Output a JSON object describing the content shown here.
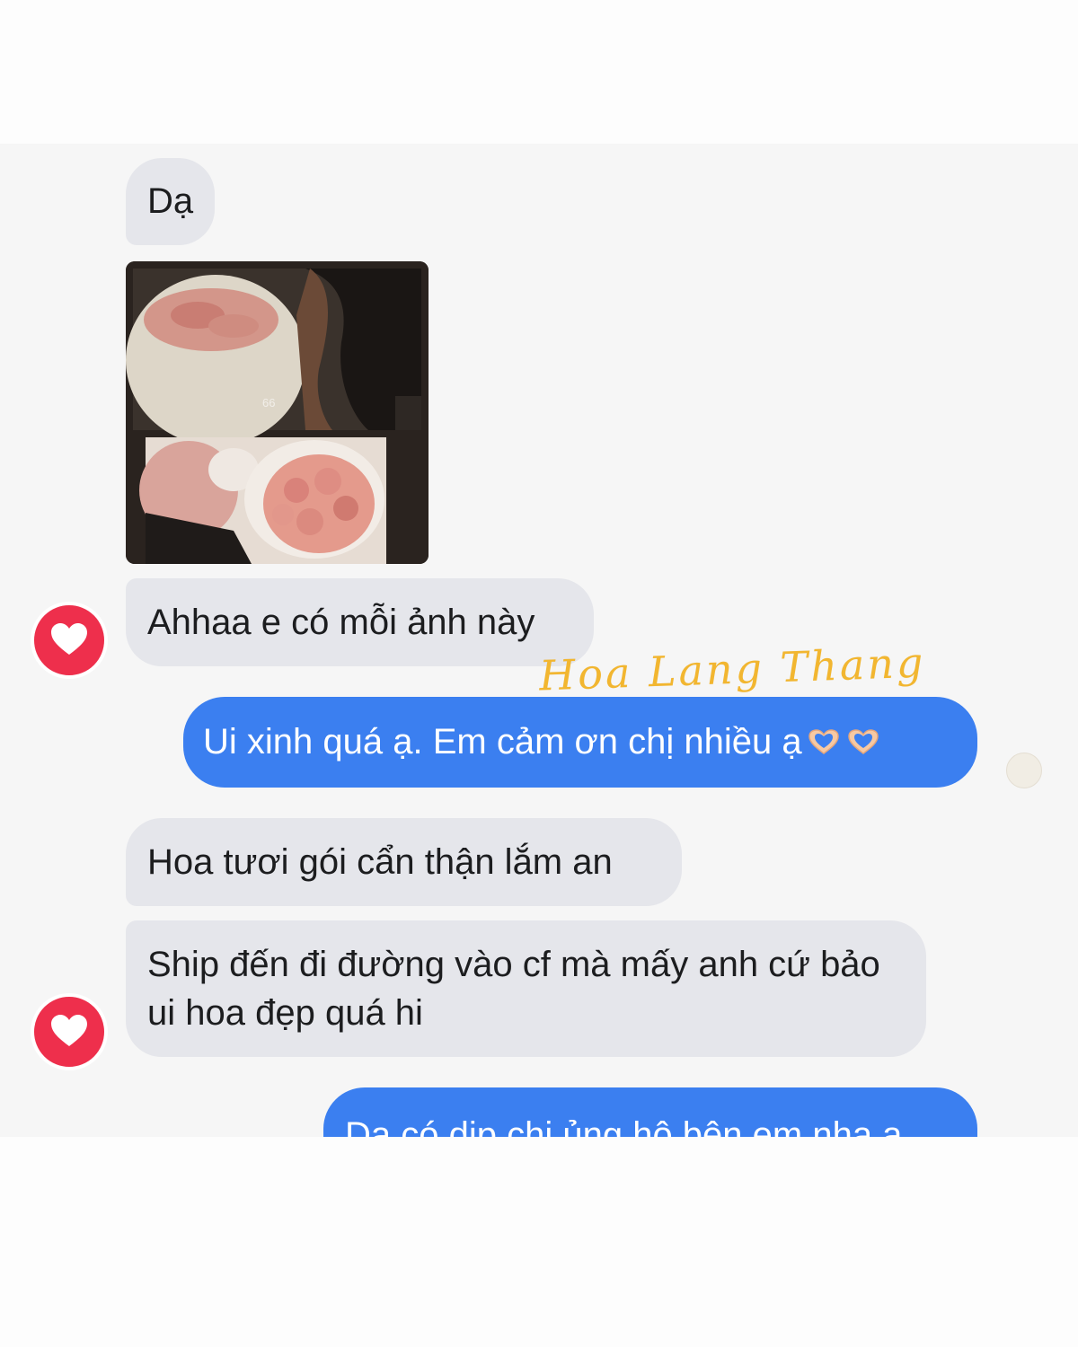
{
  "messages": [
    {
      "side": "incoming",
      "text": "Dạ"
    },
    {
      "side": "incoming",
      "type": "photo",
      "content": "bouquet-photo"
    },
    {
      "side": "incoming",
      "text": "Ahhaa e có mỗi ảnh này",
      "reaction": "heart"
    },
    {
      "side": "outgoing",
      "text": "Ui xinh quá ạ. Em cảm ơn chị nhiều ạ",
      "emoji": [
        "heart-hands-emoji",
        "heart-hands-emoji"
      ]
    },
    {
      "side": "incoming",
      "text": "Hoa tươi gói cẩn thận lắm an"
    },
    {
      "side": "incoming",
      "text": "Ship đến đi đường vào cf mà mấy anh cứ bảo ui hoa đẹp quá hi",
      "reaction": "heart"
    },
    {
      "side": "outgoing",
      "text": "Dạ có dịp chị ủng hộ bên em nha ạ"
    }
  ],
  "photo_overlay_text": "66",
  "watermark": "Hoa Lang Thang",
  "colors": {
    "incoming_bubble": "#e5e6eb",
    "outgoing_bubble": "#3b7ff0",
    "reaction": "#ee2f4c",
    "watermark": "#f2b630"
  }
}
